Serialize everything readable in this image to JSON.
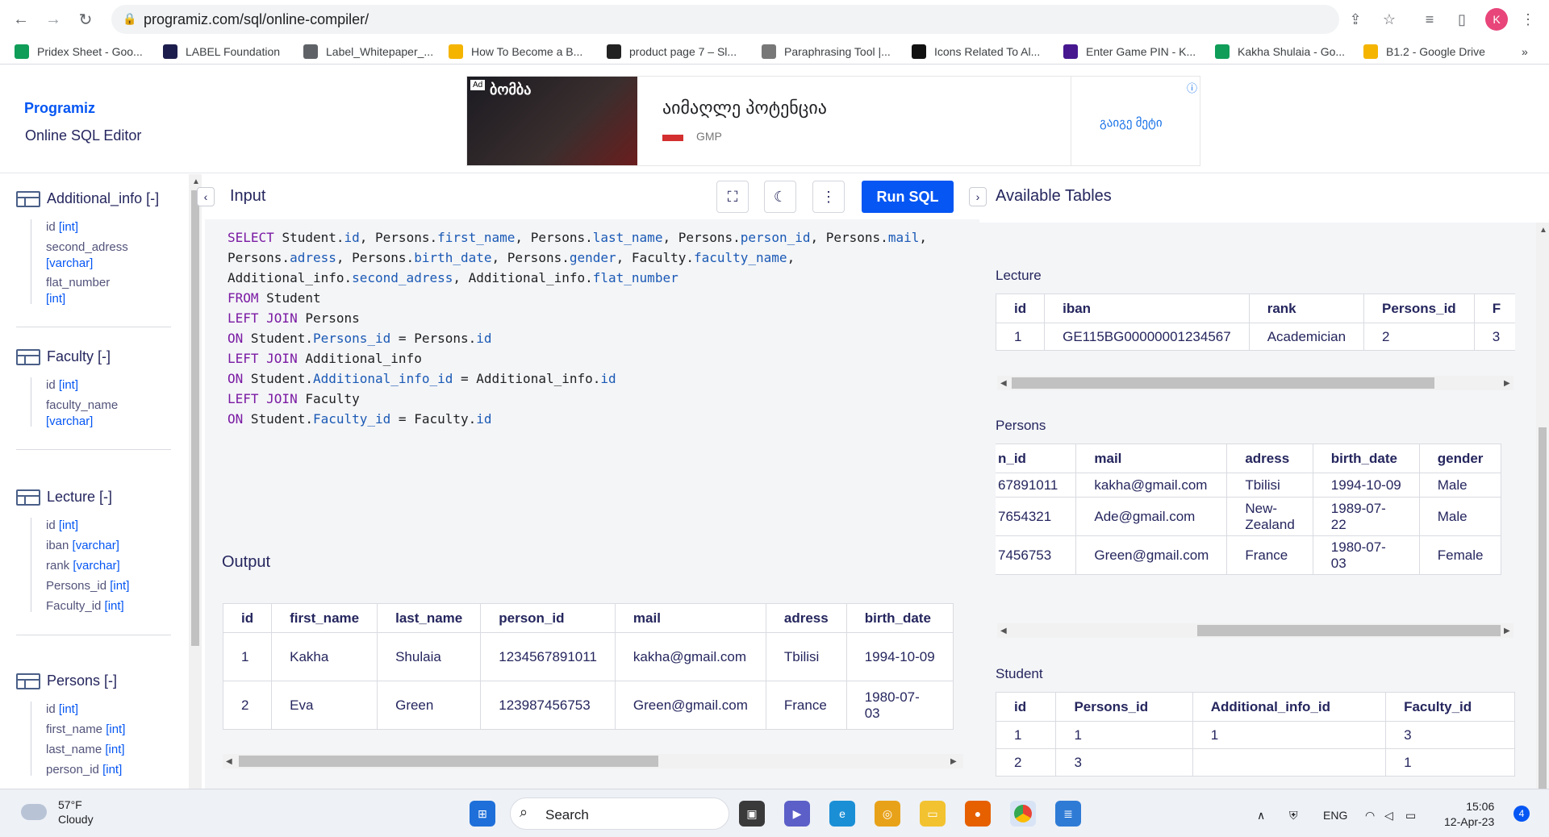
{
  "browser": {
    "url": "programiz.com/sql/online-compiler/",
    "avatar_letter": "K",
    "bookmarks": [
      {
        "label": "Pridex Sheet - Goo...",
        "icon": "sheets-icon",
        "color": "#0f9d58"
      },
      {
        "label": "LABEL Foundation",
        "icon": "label-icon",
        "color": "#1d1d4d"
      },
      {
        "label": "Label_Whitepaper_...",
        "icon": "globe-icon",
        "color": "#5f6368"
      },
      {
        "label": "How To Become a B...",
        "icon": "bar-icon",
        "color": "#f4b400"
      },
      {
        "label": "product page 7 – Sl...",
        "icon": "s-icon",
        "color": "#222222"
      },
      {
        "label": "Paraphrasing Tool |...",
        "icon": "feather-icon",
        "color": "#777777"
      },
      {
        "label": "Icons Related To Al...",
        "icon": "dots-icon",
        "color": "#111111"
      },
      {
        "label": "Enter Game PIN - K...",
        "icon": "kahoot-icon",
        "color": "#46178f"
      },
      {
        "label": "Kakha Shulaia - Go...",
        "icon": "drive-icon",
        "color": "#0f9d58"
      },
      {
        "label": "B1.2 - Google Drive",
        "icon": "drive-icon",
        "color": "#f4b400"
      }
    ],
    "more": "»"
  },
  "header": {
    "logo": "Programiz",
    "editor_name": "Online SQL Editor"
  },
  "ad": {
    "badge": "Ad",
    "image_text": "ბომბა",
    "title": "აიმაღლე პოტენცია",
    "sponsor": "GMP",
    "cta": "გაიგე მეტი",
    "info": "ⓘ"
  },
  "sidebar": {
    "tables": [
      {
        "name": "Additional_info [-]",
        "columns": [
          {
            "name": "id",
            "type": "[int]"
          },
          {
            "name": "second_adress",
            "type": "[varchar]"
          },
          {
            "name": "flat_number",
            "type": "[int]"
          }
        ]
      },
      {
        "name": "Faculty [-]",
        "columns": [
          {
            "name": "id",
            "type": "[int]"
          },
          {
            "name": "faculty_name",
            "type": "[varchar]"
          }
        ]
      },
      {
        "name": "Lecture [-]",
        "columns": [
          {
            "name": "id",
            "type": "[int]"
          },
          {
            "name": "iban",
            "type": "[varchar]"
          },
          {
            "name": "rank",
            "type": "[varchar]"
          },
          {
            "name": "Persons_id",
            "type": "[int]"
          },
          {
            "name": "Faculty_id",
            "type": "[int]"
          }
        ]
      },
      {
        "name": "Persons [-]",
        "columns": [
          {
            "name": "id",
            "type": "[int]"
          },
          {
            "name": "first_name",
            "type": "[int]"
          },
          {
            "name": "last_name",
            "type": "[int]"
          },
          {
            "name": "person_id",
            "type": "[int]"
          }
        ]
      }
    ]
  },
  "input": {
    "title": "Input",
    "run_label": "Run SQL",
    "code_lines": [
      [
        [
          "kw",
          "SELECT "
        ],
        [
          "t",
          "Student."
        ],
        [
          "fld",
          "id"
        ],
        [
          "t",
          ", Persons."
        ],
        [
          "fld",
          "first_name"
        ],
        [
          "t",
          ", Persons."
        ],
        [
          "fld",
          "last_name"
        ],
        [
          "t",
          ", Persons."
        ],
        [
          "fld",
          "person_id"
        ],
        [
          "t",
          ", Persons."
        ],
        [
          "fld",
          "mail"
        ],
        [
          "t",
          ","
        ]
      ],
      [
        [
          "t",
          "Persons."
        ],
        [
          "fld",
          "adress"
        ],
        [
          "t",
          ", Persons."
        ],
        [
          "fld",
          "birth_date"
        ],
        [
          "t",
          ", Persons."
        ],
        [
          "fld",
          "gender"
        ],
        [
          "t",
          ", Faculty."
        ],
        [
          "fld",
          "faculty_name"
        ],
        [
          "t",
          ","
        ]
      ],
      [
        [
          "t",
          "Additional_info."
        ],
        [
          "fld",
          "second_adress"
        ],
        [
          "t",
          ", Additional_info."
        ],
        [
          "fld",
          "flat_number"
        ]
      ],
      [
        [
          "kw",
          "FROM "
        ],
        [
          "t",
          "Student"
        ]
      ],
      [
        [
          "kw",
          "LEFT JOIN "
        ],
        [
          "t",
          "Persons"
        ]
      ],
      [
        [
          "kw",
          "ON "
        ],
        [
          "t",
          "Student."
        ],
        [
          "fld",
          "Persons_id"
        ],
        [
          "t",
          " = Persons."
        ],
        [
          "fld",
          "id"
        ]
      ],
      [
        [
          "kw",
          "LEFT JOIN "
        ],
        [
          "t",
          "Additional_info"
        ]
      ],
      [
        [
          "kw",
          "ON "
        ],
        [
          "t",
          "Student."
        ],
        [
          "fld",
          "Additional_info_id"
        ],
        [
          "t",
          " = Additional_info."
        ],
        [
          "fld",
          "id"
        ]
      ],
      [
        [
          "kw",
          "LEFT JOIN "
        ],
        [
          "t",
          "Faculty"
        ]
      ],
      [
        [
          "kw",
          "ON "
        ],
        [
          "t",
          "Student."
        ],
        [
          "fld",
          "Faculty_id"
        ],
        [
          "t",
          " = Faculty."
        ],
        [
          "fld",
          "id"
        ]
      ]
    ]
  },
  "output": {
    "title": "Output",
    "headers": [
      "id",
      "first_name",
      "last_name",
      "person_id",
      "mail",
      "adress",
      "birth_date"
    ],
    "rows": [
      [
        "1",
        "Kakha",
        "Shulaia",
        "1234567891011",
        "kakha@gmail.com",
        "Tbilisi",
        "1994-10-09"
      ],
      [
        "2",
        "Eva",
        "Green",
        "123987456753",
        "Green@gmail.com",
        "France",
        "1980-07-\n03"
      ]
    ]
  },
  "available": {
    "title": "Available Tables",
    "lecture": {
      "name": "Lecture",
      "headers": [
        "id",
        "iban",
        "rank",
        "Persons_id",
        "F"
      ],
      "rows": [
        [
          "1",
          "GE115BG00000001234567",
          "Academician",
          "2",
          "3"
        ]
      ]
    },
    "persons": {
      "name": "Persons",
      "headers": [
        "n_id",
        "mail",
        "adress",
        "birth_date",
        "gender"
      ],
      "rows": [
        [
          "67891011",
          "kakha@gmail.com",
          "Tbilisi",
          "1994-10-09",
          "Male"
        ],
        [
          "7654321",
          "Ade@gmail.com",
          "New-\nZealand",
          "1989-07-\n22",
          "Male"
        ],
        [
          "7456753",
          "Green@gmail.com",
          "France",
          "1980-07-\n03",
          "Female"
        ]
      ]
    },
    "student": {
      "name": "Student",
      "headers": [
        "id",
        "Persons_id",
        "Additional_info_id",
        "Faculty_id"
      ],
      "rows": [
        [
          "1",
          "1",
          "1",
          "3"
        ],
        [
          "2",
          "3",
          "",
          "1"
        ]
      ]
    }
  },
  "taskbar": {
    "temp": "57°F",
    "condition": "Cloudy",
    "search": "Search",
    "lang": "ENG",
    "time": "15:06",
    "date": "12-Apr-23",
    "notifications": "4"
  },
  "colors": {
    "accent": "#0556f3",
    "keyword": "#7a1aa3",
    "field": "#1a59b5"
  }
}
